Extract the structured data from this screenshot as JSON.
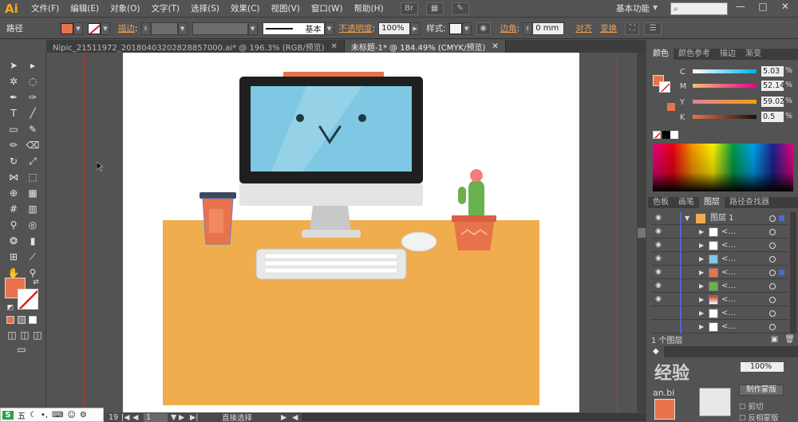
{
  "app": {
    "logo": "Ai"
  },
  "menu": [
    "文件(F)",
    "编辑(E)",
    "对象(O)",
    "文字(T)",
    "选择(S)",
    "效果(C)",
    "视图(V)",
    "窗口(W)",
    "帮助(H)"
  ],
  "workspace": "基本功能",
  "window_controls": {
    "minimize": "—",
    "maximize": "□",
    "close": "✕"
  },
  "controlbar": {
    "selection_label": "路径",
    "stroke_label": "描边",
    "stroke_style": "基本",
    "opacity_label": "不透明度",
    "opacity_value": "100%",
    "style_label": "样式",
    "corner_label": "边角",
    "corner_value": "0 mm",
    "align_label": "对齐",
    "transform_label": "变换",
    "fill_color": "#e8734a"
  },
  "tabs": [
    {
      "label": "Nipic_21511972_20180403202828857000.ai* @ 196.3% (RGB/预览)",
      "close": "✕"
    },
    {
      "label": "未标题-1* @ 184.49% (CMYK/预览)",
      "close": "✕"
    }
  ],
  "color_panel": {
    "tabs": [
      "颜色",
      "颜色参考",
      "描边",
      "渐变"
    ],
    "channels": [
      {
        "label": "C",
        "value": "5.03",
        "unit": "%"
      },
      {
        "label": "M",
        "value": "52.14",
        "unit": "%"
      },
      {
        "label": "Y",
        "value": "59.02",
        "unit": "%"
      },
      {
        "label": "K",
        "value": "0.5",
        "unit": "%"
      }
    ],
    "swatch": "#e8734a"
  },
  "layers_panel": {
    "tabs": [
      "色板",
      "画笔",
      "图层",
      "路径查找器"
    ],
    "top_layer": "图层 1",
    "sublayers": [
      "<...",
      "<...",
      "<...",
      "<...",
      "<...",
      "<...",
      "<...",
      "<..."
    ],
    "footer": "1 个图层"
  },
  "status": {
    "zoom": "19",
    "page": "1",
    "tool": "直接选择"
  },
  "ime": {
    "brand": "S",
    "mode": "五"
  },
  "watermark": {
    "text": "经验",
    "small_text": "an.bi",
    "opacity_value": "100%",
    "make_mask": "制作蒙版",
    "clip": "剪切",
    "invert_mask": "反相蒙版"
  },
  "illustration": {
    "desk_color": "#f0ad4e",
    "screen_color": "#7ec8e3",
    "monitor_frame": "#1f1f1f",
    "cup_color": "#e8734a",
    "pot_color": "#e8734a",
    "cactus_color": "#6ab04c"
  }
}
